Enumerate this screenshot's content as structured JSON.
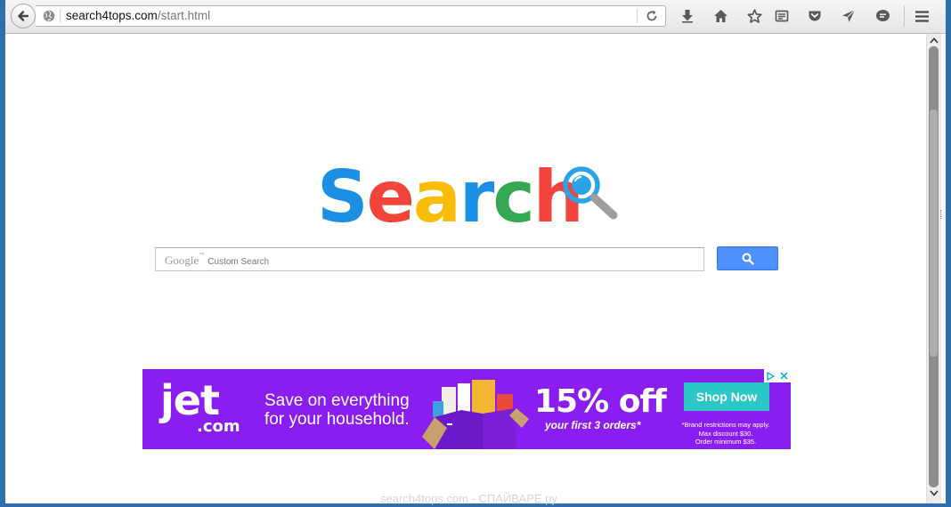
{
  "browser": {
    "url_host": "search4tops.com",
    "url_path": "/start.html",
    "accent": "#4d90fe"
  },
  "toolbar_icons": [
    "back-arrow-icon",
    "globe-icon",
    "reload-icon",
    "download-icon",
    "home-icon",
    "bookmark-star-icon",
    "reading-list-icon",
    "pocket-icon",
    "send-icon",
    "chat-icon",
    "menu-icon"
  ],
  "page": {
    "logo": {
      "letters": [
        {
          "char": "S",
          "color": "#1a8fe3"
        },
        {
          "char": "e",
          "color": "#f2443a"
        },
        {
          "char": "a",
          "color": "#fbbc05"
        },
        {
          "char": "r",
          "color": "#1a8fe3"
        },
        {
          "char": "c",
          "color": "#34a853"
        },
        {
          "char": "h",
          "color": "#f2443a"
        }
      ],
      "magnifier_color": "#2ba3e8"
    },
    "search": {
      "brand": "Google",
      "brand_tm": "™",
      "watermark": "Custom Search",
      "value": ""
    }
  },
  "ad": {
    "brand": "jet",
    "brand_domain": ".com",
    "tagline_line1": "Save on everything",
    "tagline_line2": "for your household.",
    "discount": "15% off",
    "discount_sub": "your first 3 orders*",
    "cta": "Shop Now",
    "fine_print_1": "*Brand restrictions may apply.",
    "fine_print_2": "Max discount $30.",
    "fine_print_3": "Order minimum $35.",
    "background": "#8a1df0",
    "cta_color": "#2bc6c6"
  },
  "footer_watermark": "search4tops.com - СПАЙВАРЕ.ру"
}
